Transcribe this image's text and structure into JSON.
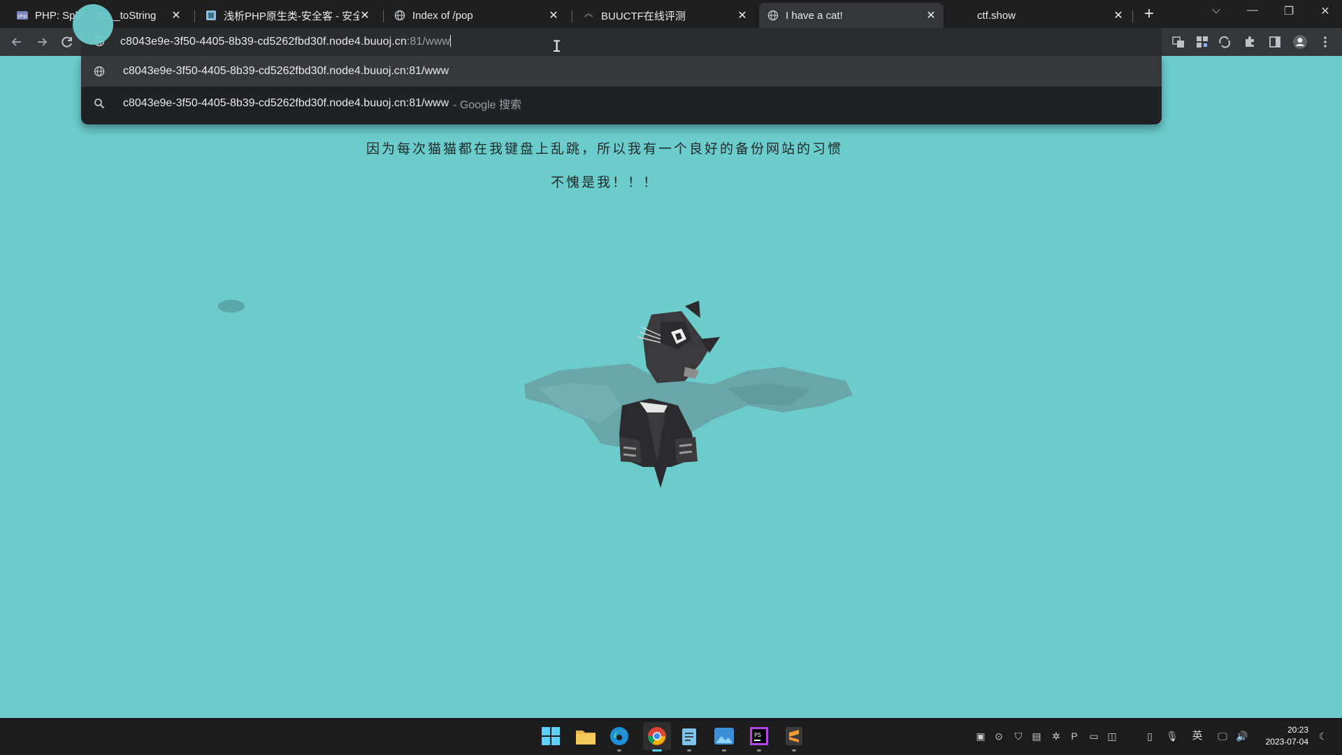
{
  "browser": {
    "tabs": [
      {
        "title": "PHP: SplF…ct::__toString",
        "icon": "php-icon",
        "active": false
      },
      {
        "title": "浅析PHP原生类-安全客 - 安全资",
        "icon": "anquanke-icon",
        "active": false
      },
      {
        "title": "Index of /pop",
        "icon": "globe-icon",
        "active": false
      },
      {
        "title": "BUUCTF在线评测",
        "icon": "buuctf-icon",
        "active": false
      },
      {
        "title": "I have a cat!",
        "icon": "globe-icon",
        "active": true
      },
      {
        "title": "ctf.show",
        "icon": "",
        "active": false
      }
    ],
    "new_tab_symbol": "+",
    "omnibox": {
      "url_host": "c8043e9e-3f50-4405-8b39-cd5262fbd30f.node4.buuoj.cn",
      "url_rest": ":81/www",
      "suggestions": [
        {
          "icon": "globe-icon",
          "text": "c8043e9e-3f50-4405-8b39-cd5262fbd30f.node4.buuoj.cn:81/www",
          "extra": ""
        },
        {
          "icon": "search-icon",
          "text": "c8043e9e-3f50-4405-8b39-cd5262fbd30f.node4.buuoj.cn:81/www",
          "extra": "- Google 搜索"
        }
      ]
    }
  },
  "page": {
    "line1": "因为每次猫猫都在我键盘上乱跳，所以我有一个良好的备份网站的习惯",
    "line2": "不愧是我！！！",
    "background": "#6ccbcb"
  },
  "taskbar": {
    "apps": [
      "windows-start-icon",
      "file-explorer-icon",
      "edge-icon",
      "chrome-icon",
      "notepad-icon",
      "photos-icon",
      "phpstorm-icon",
      "sublime-icon"
    ],
    "ime_label": "英",
    "time": "20:23",
    "date": "2023-07-04"
  }
}
